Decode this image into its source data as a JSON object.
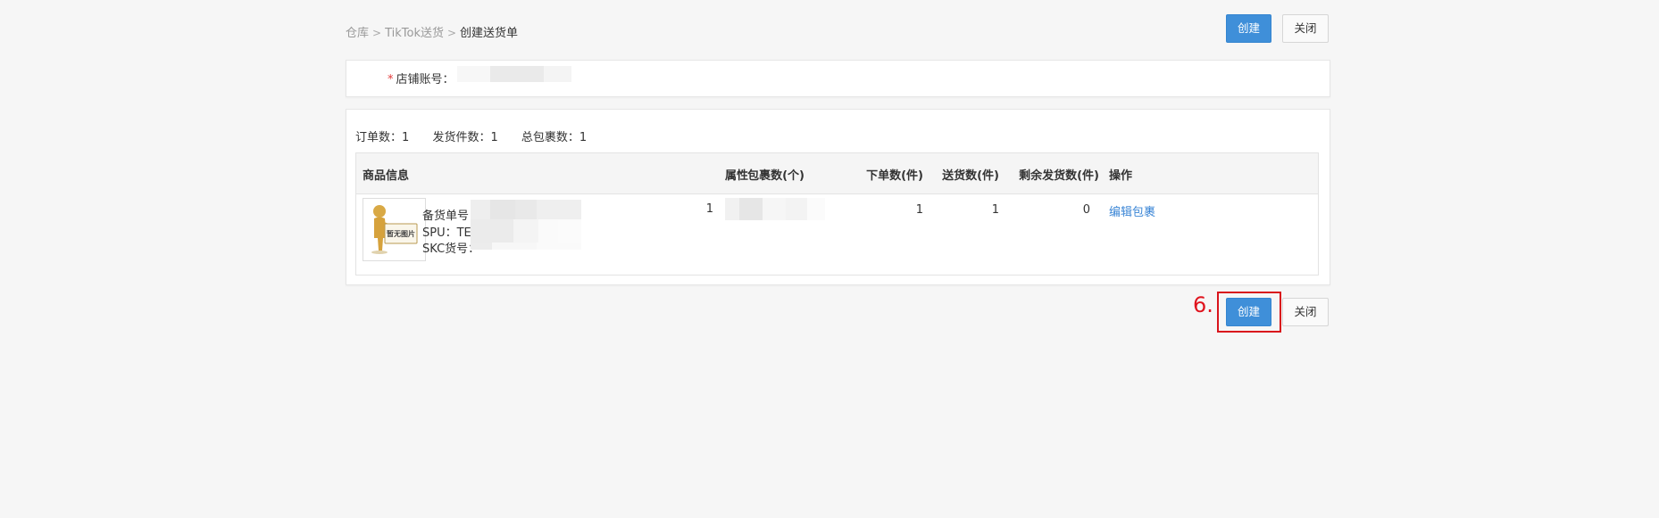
{
  "breadcrumb": {
    "item1": "仓库",
    "item2": "TikTok送货",
    "current": "创建送货单",
    "separator": ">"
  },
  "top_actions": {
    "create": "创建",
    "close": "关闭"
  },
  "store": {
    "required_mark": "*",
    "label": "店铺账号："
  },
  "stats": {
    "orders_label": "订单数：",
    "orders": "1",
    "items_label": "发货件数：",
    "items": "1",
    "packages_label": "总包裹数：",
    "packages": "1"
  },
  "table": {
    "headers": [
      "商品信息",
      "包裹数(个)",
      "属性",
      "下单数(件)",
      "送货数(件)",
      "剩余发货数(件)",
      "操作"
    ],
    "row": {
      "image_alt": "暂无图片",
      "stock_no_label": "备货单号：",
      "spu_label": "SPU：TES",
      "skc_label": "SKC货号：",
      "packages": "1",
      "ordered": "1",
      "shipped": "1",
      "remaining": "0",
      "action": "编辑包裹"
    }
  },
  "bottom_actions": {
    "create": "创建",
    "close": "关闭"
  },
  "annotation": {
    "step": "6."
  },
  "colors": {
    "primary": "#3f8fd9",
    "link": "#3b86d6",
    "required": "#e23b3b",
    "highlight": "#d9141c"
  },
  "icons": {
    "image_placeholder": "no-image-placeholder-icon"
  }
}
